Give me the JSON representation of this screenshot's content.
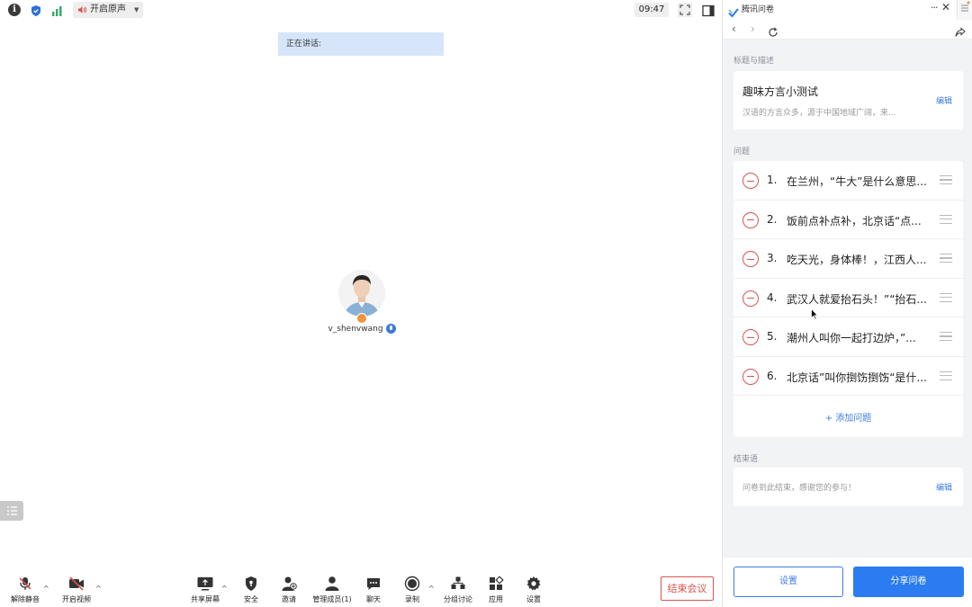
{
  "topbar": {
    "audio_label": "开启原声",
    "timer": "09:47",
    "icons": [
      "info-icon",
      "shield-icon",
      "signal-icon",
      "sound-icon",
      "fullscreen-icon",
      "layout-icon"
    ]
  },
  "meeting": {
    "speaking_label": "正在讲话:",
    "participant_name": "v_shenvwang"
  },
  "bottombar": {
    "unmute": "解除静音",
    "video": "开启视频",
    "share_screen": "共享屏幕",
    "security": "安全",
    "invite": "邀请",
    "manage": "管理成员(1)",
    "chat": "聊天",
    "record": "录制",
    "breakout": "分组讨论",
    "apps": "应用",
    "settings": "设置",
    "end_meeting": "结束会议"
  },
  "panel": {
    "title": "腾讯问卷",
    "section_title": "标题与描述",
    "survey_title": "趣味方言小测试",
    "survey_desc": "汉语的方言众多，源于中国地域广阔，来...",
    "edit": "编辑",
    "section_questions": "问题",
    "questions": [
      {
        "num": "1.",
        "text": "在兰州，“牛大”是什么意思..."
      },
      {
        "num": "2.",
        "text": "饭前点补点补，北京话“点..."
      },
      {
        "num": "3.",
        "text": "吃天光，身体棒！，江西人..."
      },
      {
        "num": "4.",
        "text": "武汉人就爱抬石头！”“抬石..."
      },
      {
        "num": "5.",
        "text": "潮州人叫你一起打边炉，”..."
      },
      {
        "num": "6.",
        "text": "北京话”叫你捯饬捯饬“是什..."
      }
    ],
    "add_question": "+ 添加问题",
    "section_end": "结束语",
    "end_text": "问卷到此结束，感谢您的参与！",
    "settings_button": "设置",
    "share_button": "分享问卷"
  },
  "colors": {
    "accent": "#2b7cf0",
    "danger": "#d9534f",
    "panel_bg": "#f2f3f5",
    "speaking_bg": "#d6e5fa"
  }
}
